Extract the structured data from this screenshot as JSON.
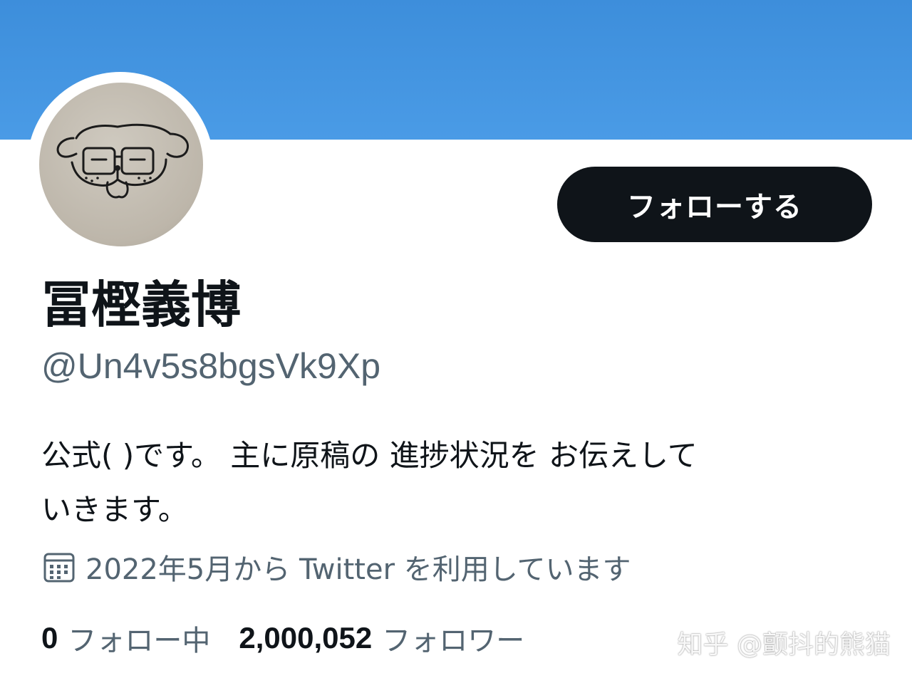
{
  "profile": {
    "display_name": "冨樫義博",
    "handle": "@Un4v5s8bgsVk9Xp",
    "bio_line1": "公式( )です。 主に原稿の 進捗状況を お伝えして",
    "bio_line2": "いきます。",
    "joined": "2022年5月から Twitter を利用しています",
    "avatar_icon": "drawn-dog-face-avatar",
    "calendar_icon": "calendar-icon"
  },
  "actions": {
    "follow_label": "フォローする"
  },
  "stats": {
    "following_count": "0",
    "following_label": "フォロー中",
    "followers_count": "2,000,052",
    "followers_label": "フォロワー"
  },
  "watermark": {
    "text": "知乎 @颤抖的熊猫"
  },
  "colors": {
    "banner": "#4a9be6",
    "button_bg": "#0f1419",
    "secondary_text": "#536471"
  }
}
